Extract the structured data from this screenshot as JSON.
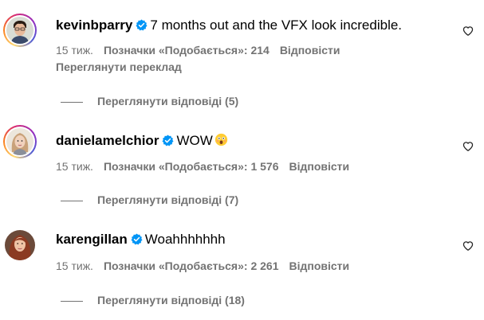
{
  "comments": [
    {
      "username": "kevinbparry",
      "text": "7 months out and the VFX look incredible.",
      "time": "15 тиж.",
      "likes": "Позначки «Подобається»: 214",
      "reply": "Відповісти",
      "translate": "Переглянути переклад",
      "view_replies": "Переглянути відповіді (5)"
    },
    {
      "username": "danielamelchior",
      "text": "WOW",
      "time": "15 тиж.",
      "likes": "Позначки «Подобається»: 1 576",
      "reply": "Відповісти",
      "view_replies": "Переглянути відповіді (7)"
    },
    {
      "username": "karengillan",
      "text": "Woahhhhhhh",
      "time": "15 тиж.",
      "likes": "Позначки «Подобається»: 2 261",
      "reply": "Відповісти",
      "view_replies": "Переглянути відповіді (18)"
    }
  ],
  "icons": {
    "verified": "verified-badge-icon",
    "like": "heart-outline-icon",
    "emoji": "astonished-face-emoji"
  },
  "colors": {
    "verified": "#0095f6",
    "secondary_text": "#737373",
    "primary_text": "#000000"
  }
}
